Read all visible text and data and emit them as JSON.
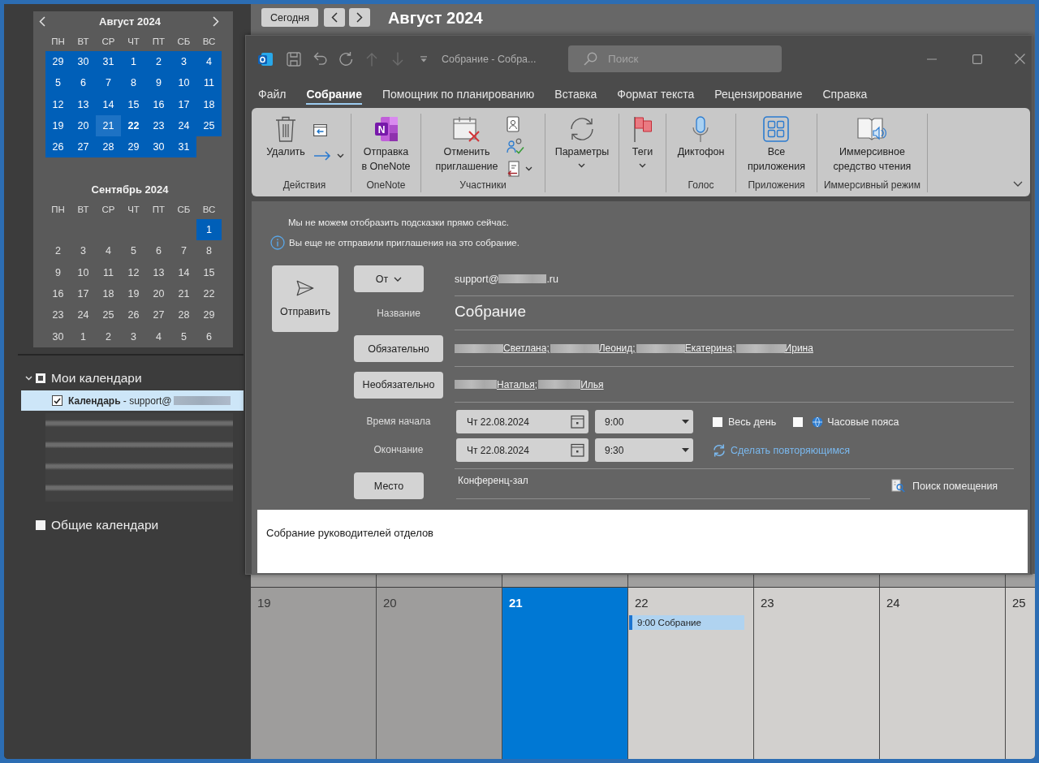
{
  "mini_calendars": [
    {
      "title": "Август 2024",
      "weekdays": [
        "ПН",
        "ВТ",
        "СР",
        "ЧТ",
        "ПТ",
        "СБ",
        "ВС"
      ],
      "weeks": [
        [
          {
            "day": "29",
            "selected": true,
            "today": false,
            "has_events": false
          },
          {
            "day": "30",
            "selected": true,
            "today": false,
            "has_events": false
          },
          {
            "day": "31",
            "selected": true,
            "today": false,
            "has_events": false
          },
          {
            "day": "1",
            "selected": true,
            "today": false,
            "has_events": false
          },
          {
            "day": "2",
            "selected": true,
            "today": false,
            "has_events": false
          },
          {
            "day": "3",
            "selected": true,
            "today": false,
            "has_events": false
          },
          {
            "day": "4",
            "selected": true,
            "today": false,
            "has_events": false
          }
        ],
        [
          {
            "day": "5",
            "selected": true,
            "today": false,
            "has_events": false
          },
          {
            "day": "6",
            "selected": true,
            "today": false,
            "has_events": false
          },
          {
            "day": "7",
            "selected": true,
            "today": false,
            "has_events": false
          },
          {
            "day": "8",
            "selected": true,
            "today": false,
            "has_events": false
          },
          {
            "day": "9",
            "selected": true,
            "today": false,
            "has_events": false
          },
          {
            "day": "10",
            "selected": true,
            "today": false,
            "has_events": false
          },
          {
            "day": "11",
            "selected": true,
            "today": false,
            "has_events": false
          }
        ],
        [
          {
            "day": "12",
            "selected": true,
            "today": false,
            "has_events": false
          },
          {
            "day": "13",
            "selected": true,
            "today": false,
            "has_events": false
          },
          {
            "day": "14",
            "selected": true,
            "today": false,
            "has_events": false
          },
          {
            "day": "15",
            "selected": true,
            "today": false,
            "has_events": false
          },
          {
            "day": "16",
            "selected": true,
            "today": false,
            "has_events": false
          },
          {
            "day": "17",
            "selected": true,
            "today": false,
            "has_events": false
          },
          {
            "day": "18",
            "selected": true,
            "today": false,
            "has_events": false
          }
        ],
        [
          {
            "day": "19",
            "selected": true,
            "today": false,
            "has_events": false
          },
          {
            "day": "20",
            "selected": true,
            "today": false,
            "has_events": false
          },
          {
            "day": "21",
            "selected": true,
            "today": true,
            "has_events": false
          },
          {
            "day": "22",
            "selected": true,
            "today": false,
            "has_events": true
          },
          {
            "day": "23",
            "selected": true,
            "today": false,
            "has_events": false
          },
          {
            "day": "24",
            "selected": true,
            "today": false,
            "has_events": false
          },
          {
            "day": "25",
            "selected": true,
            "today": false,
            "has_events": false
          }
        ],
        [
          {
            "day": "26",
            "selected": true,
            "today": false,
            "has_events": false
          },
          {
            "day": "27",
            "selected": true,
            "today": false,
            "has_events": false
          },
          {
            "day": "28",
            "selected": true,
            "today": false,
            "has_events": false
          },
          {
            "day": "29",
            "selected": true,
            "today": false,
            "has_events": false
          },
          {
            "day": "30",
            "selected": true,
            "today": false,
            "has_events": false
          },
          {
            "day": "31",
            "selected": true,
            "today": false,
            "has_events": false
          }
        ]
      ]
    },
    {
      "title": "Сентябрь 2024",
      "weekdays": [
        "ПН",
        "ВТ",
        "СР",
        "ЧТ",
        "ПТ",
        "СБ",
        "ВС"
      ],
      "weeks": [
        [
          {
            "day": "1",
            "selected": true,
            "today": false,
            "has_events": false
          }
        ],
        [
          {
            "day": "2",
            "selected": false,
            "today": false,
            "has_events": false
          },
          {
            "day": "3",
            "selected": false,
            "today": false,
            "has_events": false
          },
          {
            "day": "4",
            "selected": false,
            "today": false,
            "has_events": false
          },
          {
            "day": "5",
            "selected": false,
            "today": false,
            "has_events": false
          },
          {
            "day": "6",
            "selected": false,
            "today": false,
            "has_events": false
          },
          {
            "day": "7",
            "selected": false,
            "today": false,
            "has_events": false
          },
          {
            "day": "8",
            "selected": false,
            "today": false,
            "has_events": false
          }
        ],
        [
          {
            "day": "9",
            "selected": false,
            "today": false,
            "has_events": false
          },
          {
            "day": "10",
            "selected": false,
            "today": false,
            "has_events": false
          },
          {
            "day": "11",
            "selected": false,
            "today": false,
            "has_events": false
          },
          {
            "day": "12",
            "selected": false,
            "today": false,
            "has_events": false
          },
          {
            "day": "13",
            "selected": false,
            "today": false,
            "has_events": false
          },
          {
            "day": "14",
            "selected": false,
            "today": false,
            "has_events": false
          },
          {
            "day": "15",
            "selected": false,
            "today": false,
            "has_events": false
          }
        ],
        [
          {
            "day": "16",
            "selected": false,
            "today": false,
            "has_events": false
          },
          {
            "day": "17",
            "selected": false,
            "today": false,
            "has_events": false
          },
          {
            "day": "18",
            "selected": false,
            "today": false,
            "has_events": false
          },
          {
            "day": "19",
            "selected": false,
            "today": false,
            "has_events": false
          },
          {
            "day": "20",
            "selected": false,
            "today": false,
            "has_events": false
          },
          {
            "day": "21",
            "selected": false,
            "today": false,
            "has_events": false
          },
          {
            "day": "22",
            "selected": false,
            "today": false,
            "has_events": false
          }
        ],
        [
          {
            "day": "23",
            "selected": false,
            "today": false,
            "has_events": false
          },
          {
            "day": "24",
            "selected": false,
            "today": false,
            "has_events": false
          },
          {
            "day": "25",
            "selected": false,
            "today": false,
            "has_events": false
          },
          {
            "day": "26",
            "selected": false,
            "today": false,
            "has_events": false
          },
          {
            "day": "27",
            "selected": false,
            "today": false,
            "has_events": false
          },
          {
            "day": "28",
            "selected": false,
            "today": false,
            "has_events": false
          },
          {
            "day": "29",
            "selected": false,
            "today": false,
            "has_events": false
          }
        ],
        [
          {
            "day": "30",
            "selected": false,
            "today": false,
            "has_events": false
          },
          {
            "day": "1",
            "selected": false,
            "today": false,
            "has_events": false
          },
          {
            "day": "2",
            "selected": false,
            "today": false,
            "has_events": false
          },
          {
            "day": "3",
            "selected": false,
            "today": false,
            "has_events": false
          },
          {
            "day": "4",
            "selected": false,
            "today": false,
            "has_events": false
          },
          {
            "day": "5",
            "selected": false,
            "today": false,
            "has_events": false
          },
          {
            "day": "6",
            "selected": false,
            "today": false,
            "has_events": false
          }
        ]
      ]
    }
  ],
  "calendar_groups": [
    {
      "label": "Мои календари",
      "expanded": true,
      "partial": true,
      "children": [
        {
          "label": "**Календарь** - support@",
          "checked": true,
          "selected": true
        }
      ]
    },
    {
      "label": "Общие календари",
      "checked": false,
      "partial": false
    }
  ],
  "topbar": {
    "today_button": "Сегодня",
    "title": "Август 2024"
  },
  "window": {
    "title": "Собрание - Собра...",
    "search_placeholder": "Поиск",
    "quick_access": [
      {
        "disabled": false
      },
      {
        "disabled": false
      },
      {
        "disabled": false
      },
      {
        "disabled": true
      },
      {
        "disabled": true
      },
      {
        "disabled": false
      }
    ]
  },
  "tabs": [
    {
      "label": "Файл",
      "selected": false
    },
    {
      "label": "Собрание",
      "selected": true
    },
    {
      "label": "Помощник по планированию",
      "selected": false
    },
    {
      "label": "Вставка",
      "selected": false
    },
    {
      "label": "Формат текста",
      "selected": false
    },
    {
      "label": "Рецензирование",
      "selected": false
    },
    {
      "label": "Справка",
      "selected": false
    }
  ],
  "ribbon": {
    "groups": [
      {
        "label": "Действия",
        "buttons": [
          {
            "label": "Удалить",
            "dropdown": false
          }
        ]
      },
      {
        "label": "OneNote",
        "buttons": [
          {
            "label": "Отправка\nв OneNote",
            "dropdown": false,
            "logo_text": "N"
          }
        ]
      },
      {
        "label": "Участники",
        "buttons": [
          {
            "label": "Отменить\nприглашение",
            "dropdown": false
          }
        ]
      },
      {
        "buttons": [
          {
            "label": "Параметры",
            "dropdown": true
          }
        ]
      },
      {
        "buttons": [
          {
            "label": "Теги",
            "dropdown": true
          }
        ]
      },
      {
        "label": "Голос",
        "buttons": [
          {
            "label": "Диктофон",
            "dropdown": false
          }
        ]
      },
      {
        "label": "Приложения",
        "buttons": [
          {
            "label": "Все\nприложения",
            "dropdown": false
          }
        ]
      },
      {
        "label": "Иммерсивный режим",
        "buttons": [
          {
            "label": "Иммерсивное\nсредство чтения",
            "dropdown": false
          }
        ]
      }
    ]
  },
  "form": {
    "notices": [
      {
        "kind": "plain",
        "text": "Мы не можем отобразить подсказки прямо сейчас."
      },
      {
        "kind": "info",
        "text": "Вы еще не отправили приглашения на это собрание."
      }
    ],
    "send_button": "Отправить",
    "from": {
      "button": "От",
      "user": "support@",
      "domain_suffix": ".ru"
    },
    "subject": {
      "label": "Название",
      "value": "Собрание"
    },
    "required": {
      "button": "Обязательно",
      "attendees": [
        "Светлана;",
        "Леонид;",
        "Екатерина;",
        "Ирина"
      ]
    },
    "optional": {
      "button": "Необязательно",
      "attendees": [
        "Наталья;",
        "Илья"
      ]
    },
    "start": {
      "label": "Время начала",
      "date": "Чт 22.08.2024",
      "time": "9:00"
    },
    "end": {
      "label": "Окончание",
      "date": "Чт 22.08.2024",
      "time": "9:30"
    },
    "all_day": {
      "label": "Весь день",
      "checked": false
    },
    "time_zones": {
      "label": "Часовые пояса",
      "checked": false
    },
    "recurrence_link": "Сделать повторяющимся",
    "location": {
      "button": "Место",
      "value": "Конференц-зал"
    },
    "room_finder": "Поиск помещения",
    "body": "Собрание руководителей отделов"
  },
  "calendar_week": {
    "days": [
      {
        "day": "19",
        "past": true,
        "today": false
      },
      {
        "day": "20",
        "past": true,
        "today": false
      },
      {
        "day": "21",
        "past": false,
        "today": true
      },
      {
        "day": "22",
        "past": false,
        "today": false,
        "events": [
          {
            "time": "9:00",
            "title": "Собрание"
          }
        ]
      },
      {
        "day": "23",
        "past": false,
        "today": false
      },
      {
        "day": "24",
        "past": false,
        "today": false
      },
      {
        "day": "25",
        "past": false,
        "today": false
      }
    ]
  }
}
